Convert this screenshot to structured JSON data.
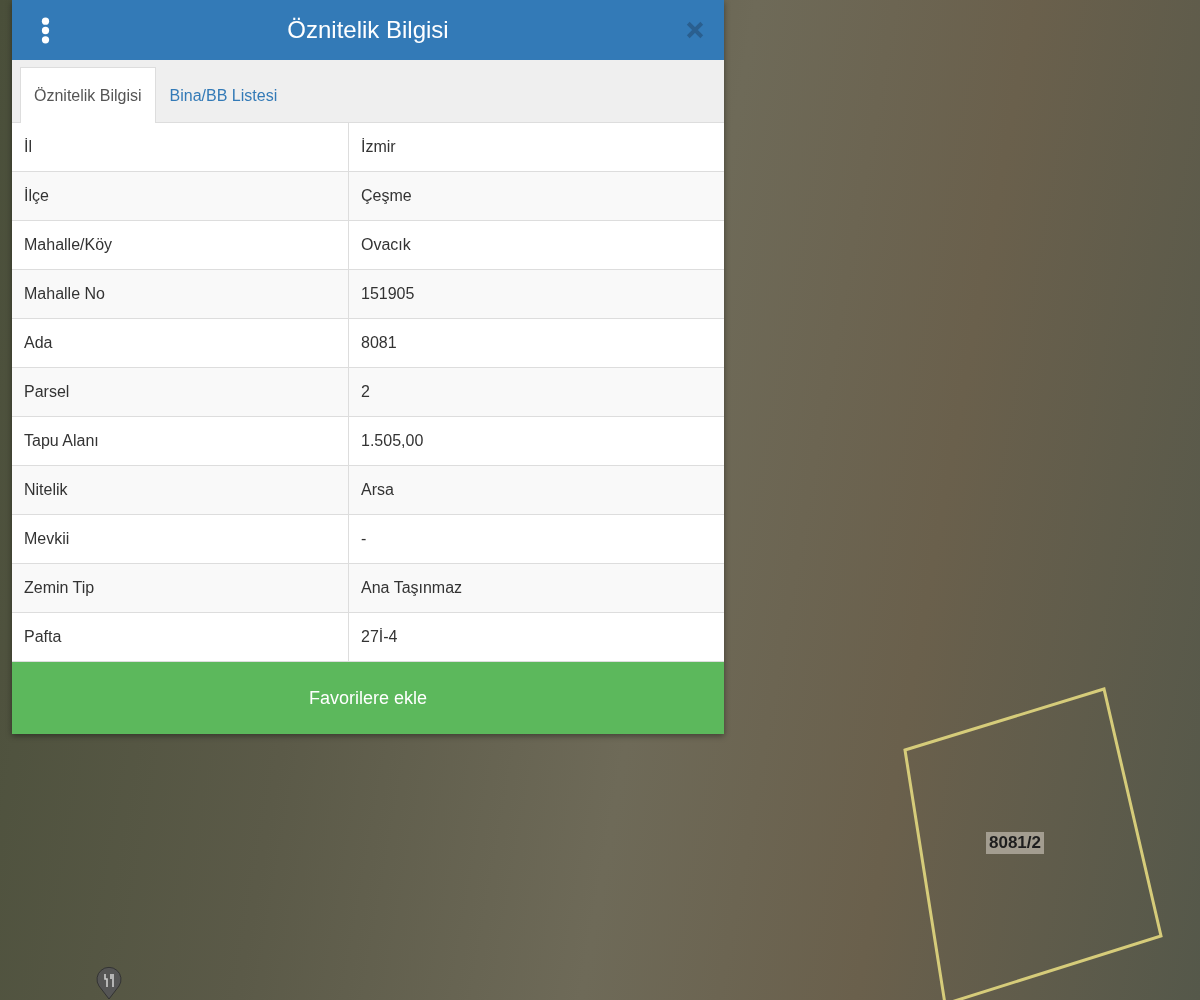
{
  "panel": {
    "title": "Öznitelik Bilgisi",
    "tabs": [
      {
        "label": "Öznitelik Bilgisi",
        "selected": true
      },
      {
        "label": "Bina/BB Listesi",
        "selected": false
      }
    ],
    "rows": [
      {
        "label": "İl",
        "value": "İzmir"
      },
      {
        "label": "İlçe",
        "value": "Çeşme"
      },
      {
        "label": "Mahalle/Köy",
        "value": "Ovacık"
      },
      {
        "label": "Mahalle No",
        "value": "151905"
      },
      {
        "label": "Ada",
        "value": "8081"
      },
      {
        "label": "Parsel",
        "value": "2"
      },
      {
        "label": "Tapu Alanı",
        "value": "1.505,00"
      },
      {
        "label": "Nitelik",
        "value": "Arsa"
      },
      {
        "label": "Mevkii",
        "value": "-"
      },
      {
        "label": "Zemin Tip",
        "value": "Ana Taşınmaz"
      },
      {
        "label": "Pafta",
        "value": "27İ-4"
      }
    ],
    "button": "Favorilere ekle"
  },
  "map": {
    "parcel_label": "8081/2"
  }
}
